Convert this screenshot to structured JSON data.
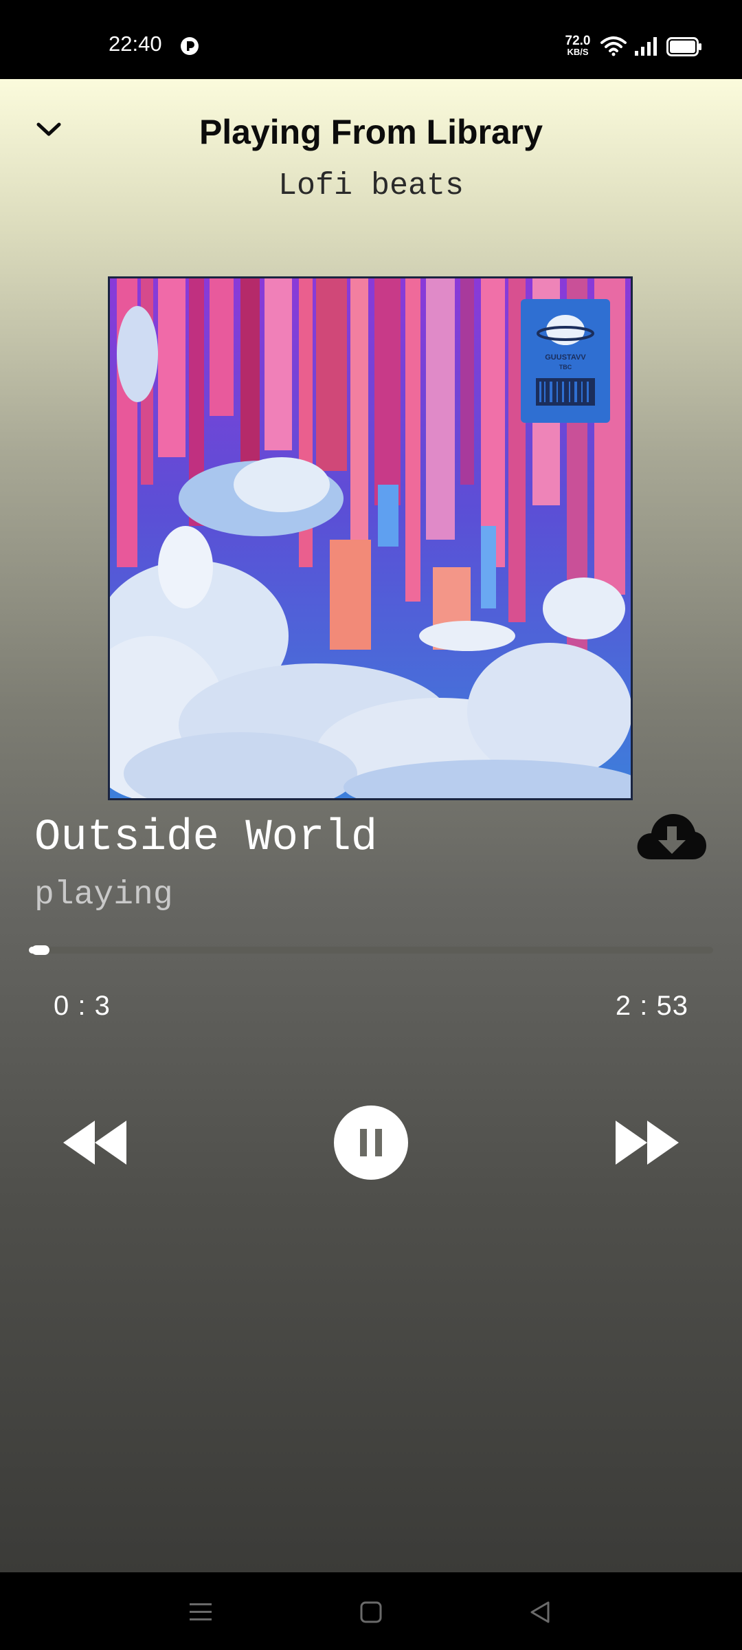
{
  "status_bar": {
    "time": "22:40",
    "net_speed_value": "72.0",
    "net_speed_unit": "KB/S",
    "app_icon": "circle-p-icon",
    "icons": [
      "wifi-icon",
      "signal-icon",
      "battery-icon"
    ]
  },
  "header": {
    "title": "Playing From Library",
    "subtitle": "Lofi beats",
    "collapse_icon": "chevron-down-icon"
  },
  "album_art": {
    "sticker_text": "GUUSTAVV",
    "sticker_sub": "TBC"
  },
  "track": {
    "title": "Outside World",
    "status": "playing",
    "download_icon": "cloud-download-icon"
  },
  "progress": {
    "current": "0 : 3",
    "total": "2 : 53",
    "fraction": 0.017
  },
  "controls": {
    "rewind_icon": "rewind-icon",
    "pause_icon": "pause-icon",
    "forward_icon": "fast-forward-icon"
  },
  "nav_bar": {
    "icons": [
      "menu-icon",
      "home-icon",
      "back-icon"
    ]
  },
  "colors": {
    "gradient_top": "#fbfbdc",
    "gradient_bottom": "#3b3b38",
    "text_dark": "#0c0c0c",
    "text_light": "#ffffff"
  }
}
